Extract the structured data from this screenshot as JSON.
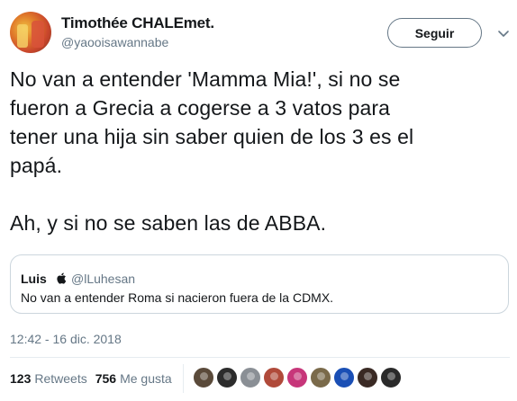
{
  "author": {
    "display_name": "Timothée CHALEmet.",
    "handle": "@yaooisawannabe"
  },
  "follow_button": {
    "label": "Seguir"
  },
  "tweet": {
    "text": "No van a entender 'Mamma Mia!', si no se\nfueron a Grecia a cogerse a 3 vatos para\ntener una hija sin saber quien de los 3 es el\npapá.\n\nAh, y si no se saben las de ABBA."
  },
  "quoted_tweet": {
    "name": "Luis",
    "handle": "@lLuhesan",
    "text": "No van a entender Roma si nacieron fuera de la CDMX."
  },
  "timestamp": "12:42 - 16 dic. 2018",
  "stats": {
    "retweets_count": "123",
    "retweets_label": "Retweets",
    "likes_count": "756",
    "likes_label": "Me gusta"
  },
  "liker_avatar_colors": [
    "#5a4a3a",
    "#2c2c2c",
    "#8a8f95",
    "#b04a3a",
    "#c7367a",
    "#7a6a4a",
    "#1a4fb5",
    "#3a2a24",
    "#2a2a2a"
  ],
  "icons": {
    "caret": "chevron-down-icon",
    "verified_apple": "apple-icon"
  }
}
